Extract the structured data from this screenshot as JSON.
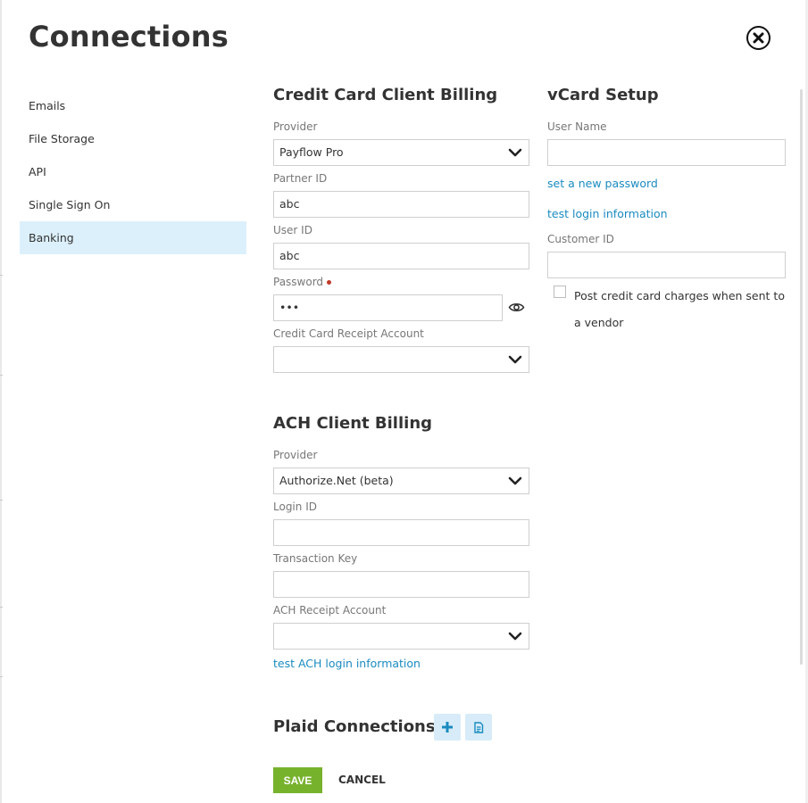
{
  "dialog": {
    "title": "Connections"
  },
  "nav": {
    "items": [
      {
        "label": "Emails"
      },
      {
        "label": "File Storage"
      },
      {
        "label": "API"
      },
      {
        "label": "Single Sign On"
      },
      {
        "label": "Banking",
        "active": true
      }
    ]
  },
  "credit_card": {
    "title": "Credit Card Client Billing",
    "provider_label": "Provider",
    "provider_value": "Payflow Pro",
    "partner_id_label": "Partner ID",
    "partner_id_value": "abc",
    "user_id_label": "User ID",
    "user_id_value": "abc",
    "password_label": "Password",
    "password_value": "•••",
    "receipt_account_label": "Credit Card Receipt Account",
    "receipt_account_value": ""
  },
  "ach": {
    "title": "ACH Client Billing",
    "provider_label": "Provider",
    "provider_value": "Authorize.Net (beta)",
    "login_id_label": "Login ID",
    "login_id_value": "",
    "transaction_key_label": "Transaction Key",
    "transaction_key_value": "",
    "receipt_account_label": "ACH Receipt Account",
    "receipt_account_value": "",
    "test_link": "test ACH login information"
  },
  "vcard": {
    "title": "vCard Setup",
    "user_name_label": "User Name",
    "user_name_value": "",
    "set_password_link": "set a new password",
    "test_login_link": "test login information",
    "customer_id_label": "Customer ID",
    "customer_id_value": "",
    "post_charges_label": "Post credit card charges when sent to a vendor"
  },
  "plaid": {
    "title": "Plaid Connections"
  },
  "footer": {
    "save_label": "SAVE",
    "cancel_label": "CANCEL"
  },
  "colors": {
    "accent": "#1a8bc0",
    "save": "#77b22d",
    "nav_active": "#dcf0fb",
    "icon_btn": "#d7ecf8"
  },
  "icons": [
    "close-icon",
    "chevron-down-icon",
    "eye-icon",
    "plus-icon",
    "document-icon"
  ]
}
